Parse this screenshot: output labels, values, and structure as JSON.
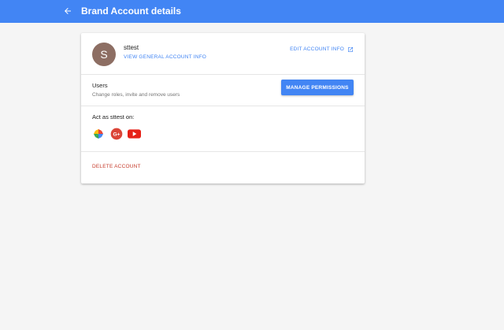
{
  "appbar": {
    "title": "Brand Account details",
    "back_icon": "arrow-back-icon",
    "color": "#4285f4"
  },
  "account": {
    "avatar_letter": "S",
    "avatar_color": "#8d6e63",
    "name": "sttest",
    "view_link": "VIEW GENERAL ACCOUNT INFO",
    "edit_link": "EDIT ACCOUNT INFO",
    "edit_icon": "open-in-new-icon"
  },
  "users": {
    "title": "Users",
    "subtitle": "Change roles, invite and remove users",
    "manage_button": "MANAGE PERMISSIONS"
  },
  "act_as": {
    "title": "Act as sttest on:",
    "apps": [
      "photos-icon",
      "google-plus-icon",
      "youtube-icon"
    ]
  },
  "delete": {
    "label": "DELETE ACCOUNT",
    "color": "#c53929"
  }
}
